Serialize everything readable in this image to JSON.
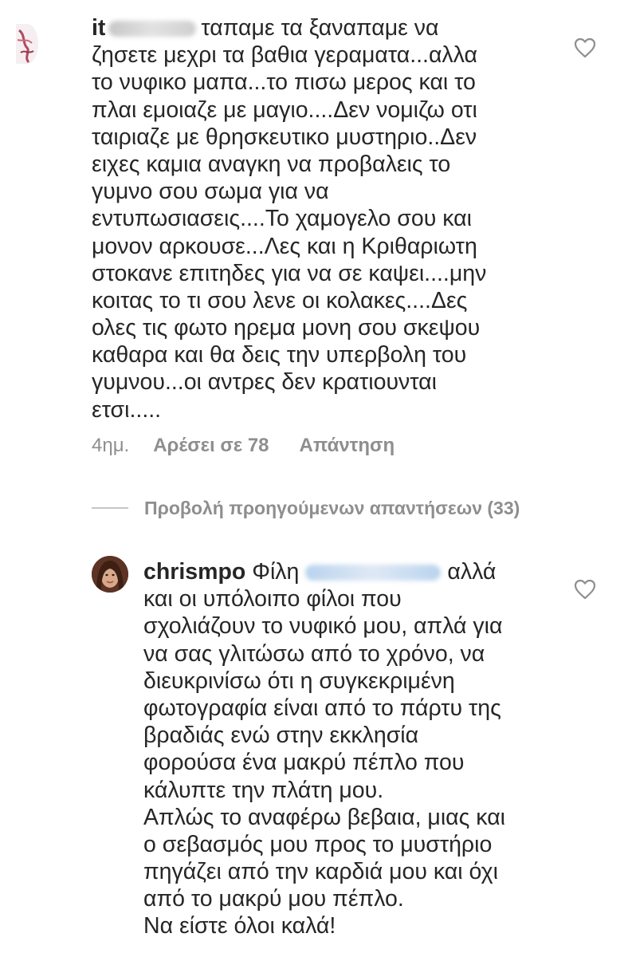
{
  "comment1": {
    "username_fragment": "it",
    "lines": [
      "ταπαμε τα ξαναπαμε να",
      "ζησετε μεχρι τα βαθια γεραματα...αλλα",
      "το νυφικο μαπα...το πισω μερος και το",
      "πλαι εμοιαζε με μαγιο....Δεν νομιζω οτι",
      "ταιριαζε με θρησκευτικο μυστηριο..Δεν",
      "ειχες καμια αναγκη να προβαλεις το",
      "γυμνο σου σωμα για να",
      "εντυπωσιασεις....Το χαμογελο σου και",
      "μονον αρκουσε...Λες και η Κριθαριωτη",
      "στοκανε επιτηδες για να σε καψει....μην",
      "κοιτας το τι σου λενε οι κολακες....Δες",
      "ολες τις φωτο ηρεμα μονη σου σκεψου",
      "καθαρα και θα δεις την υπερβολη του",
      "γυμνου...οι αντρες δεν κρατιουνται",
      "ετσι....."
    ],
    "age": "4ημ.",
    "likes": "Αρέσει σε 78",
    "reply": "Απάντηση"
  },
  "view_replies": {
    "label": "Προβολή προηγούμενων απαντήσεων (33)"
  },
  "comment2": {
    "username": "chrismpo",
    "first_line_start": "Φίλη",
    "first_line_end": "αλλά",
    "lines": [
      "και οι υπόλοιπο φίλοι που",
      "σχολιάζουν το νυφικό μου, απλά για",
      "να σας γλιτώσω από το χρόνο, να",
      "διευκρινίσω ότι η συγκεκριμένη",
      "φωτογραφία είναι από το πάρτυ της",
      "βραδιάς ενώ στην εκκλησία",
      "φορούσα ένα μακρύ πέπλο που",
      "κάλυπτε την πλάτη μου.",
      "Απλώς το αναφέρω βεβαια, μιας και",
      "ο σεβασμός μου προς το μυστήριο",
      "πηγάζει από την καρδιά μου και όχι",
      "από το μακρύ μου πέπλο.",
      "Να είστε όλοι καλά!"
    ]
  },
  "icons": {
    "heart": "heart-outline-icon",
    "avatar": "profile-avatar"
  },
  "colors": {
    "text": "#262626",
    "meta": "#8e8e8e",
    "divider": "#c7c7c7"
  }
}
